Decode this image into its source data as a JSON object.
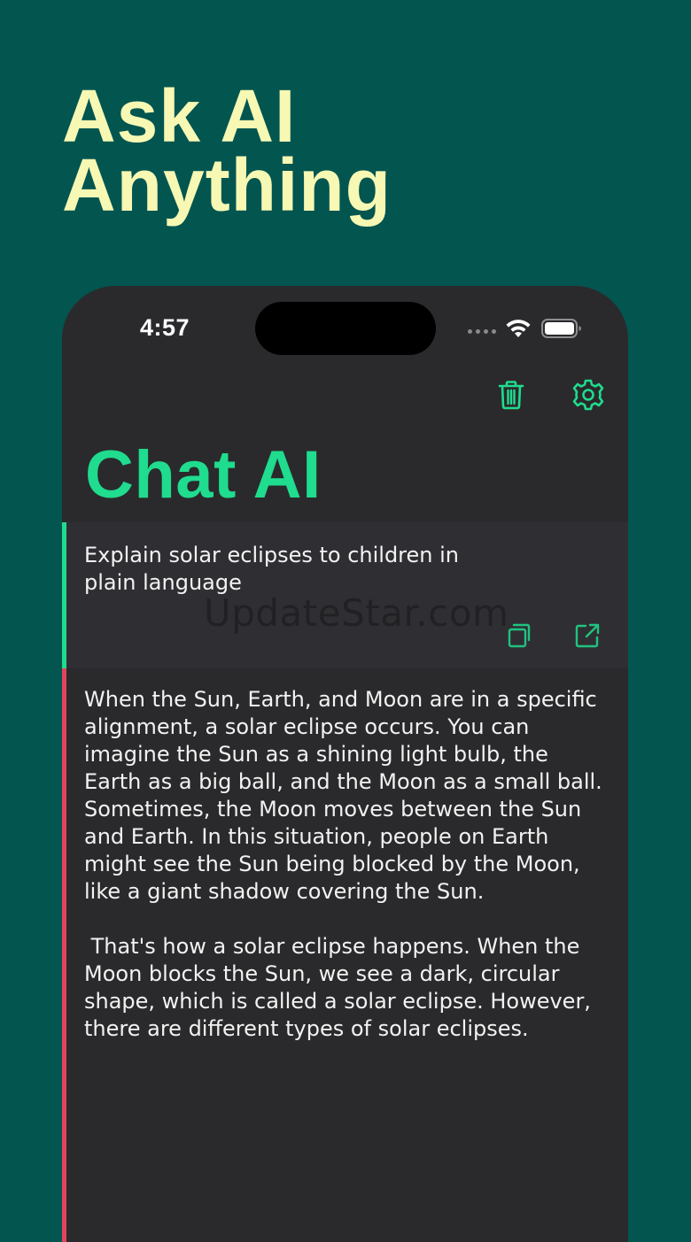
{
  "promo": {
    "headline_line1": "Ask AI",
    "headline_line2": "Anything"
  },
  "status_bar": {
    "time": "4:57"
  },
  "header": {
    "title": "Chat AI",
    "actions": [
      {
        "icon": "trash-icon",
        "label": ""
      },
      {
        "icon": "gear-icon",
        "label": ""
      }
    ]
  },
  "conversation": {
    "prompt": "Explain solar eclipses to children in plain language",
    "prompt_actions": [
      {
        "icon": "copy-icon"
      },
      {
        "icon": "share-icon"
      }
    ],
    "response_paragraph_1": "When the Sun, Earth, and Moon are in a specific alignment, a solar eclipse occurs. You can imagine the Sun as a shining light bulb, the Earth as a big ball, and the Moon as a small ball. Sometimes, the Moon moves between the Sun and Earth. In this situation, people on Earth might see the Sun being blocked by the Moon, like a giant shadow covering the Sun.",
    "response_paragraph_2": " That's how a solar eclipse happens. When the Moon blocks the Sun, we see a dark, circular shape, which is called a solar eclipse. However, there are different types of solar eclipses."
  },
  "watermark": "UpdateStar.com",
  "colors": {
    "background": "#035550",
    "headline": "#f6f8b3",
    "accent": "#1fdc8e",
    "response_bar": "#e5435c",
    "panel": "#2a2a2c"
  }
}
